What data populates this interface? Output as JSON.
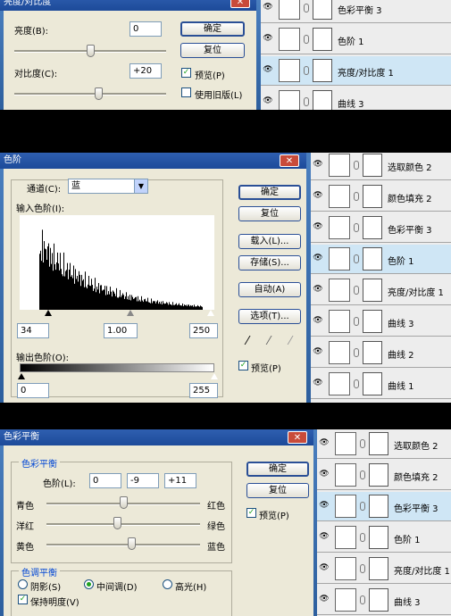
{
  "bc": {
    "title": "亮度/对比度",
    "close": "✕",
    "brightness_label": "亮度(B):",
    "brightness_value": "0",
    "contrast_label": "对比度(C):",
    "contrast_value": "+20",
    "ok": "确定",
    "reset": "复位",
    "preview": "预览(P)",
    "legacy": "使用旧版(L)",
    "brightness_level": 0.5,
    "contrast_level": 0.55
  },
  "panel1": [
    {
      "name": "色彩平衡 3",
      "icon": "color-balance-icon",
      "selected": false
    },
    {
      "name": "色阶 1",
      "icon": "levels-icon",
      "selected": false
    },
    {
      "name": "亮度/对比度 1",
      "icon": "brightness-contrast-icon",
      "selected": true
    },
    {
      "name": "曲线 3",
      "icon": "curves-icon",
      "selected": false
    }
  ],
  "lv": {
    "title": "色阶",
    "close": "✕",
    "channel_label": "通道(C):",
    "channel_value": "蓝",
    "input_label": "输入色阶(I):",
    "input_black": "34",
    "input_gamma": "1.00",
    "input_white": "250",
    "output_label": "输出色阶(O):",
    "output_black": "0",
    "output_white": "255",
    "ok": "确定",
    "reset": "复位",
    "load": "载入(L)...",
    "save": "存储(S)...",
    "auto": "自动(A)",
    "options": "选项(T)...",
    "preview": "预览(P)"
  },
  "panel2": [
    {
      "name": "选取颜色 2",
      "icon": "selective-color-icon",
      "selected": false
    },
    {
      "name": "颜色填充 2",
      "icon": "color-fill-icon",
      "selected": false
    },
    {
      "name": "色彩平衡 3",
      "icon": "color-balance-icon",
      "selected": false
    },
    {
      "name": "色阶 1",
      "icon": "levels-icon",
      "selected": true
    },
    {
      "name": "亮度/对比度 1",
      "icon": "brightness-contrast-icon",
      "selected": false
    },
    {
      "name": "曲线 3",
      "icon": "curves-icon",
      "selected": false
    },
    {
      "name": "曲线 2",
      "icon": "curves-icon",
      "selected": false
    },
    {
      "name": "曲线 1",
      "icon": "curves-icon",
      "selected": false
    }
  ],
  "cb": {
    "title": "色彩平衡",
    "close": "✕",
    "group_title": "色彩平衡",
    "levels_label": "色阶(L):",
    "v1": "0",
    "v2": "-9",
    "v3": "+11",
    "cyan": "青色",
    "red": "红色",
    "magenta": "洋红",
    "green": "绿色",
    "yellow": "黄色",
    "blue": "蓝色",
    "tone_title": "色调平衡",
    "shadows": "阴影(S)",
    "midtones": "中间调(D)",
    "highlights": "高光(H)",
    "preserve": "保持明度(V)",
    "ok": "确定",
    "reset": "复位",
    "preview": "预览(P)",
    "slider_levels": [
      0.5,
      0.46,
      0.55
    ]
  },
  "panel3": [
    {
      "name": "选取颜色 2",
      "icon": "selective-color-icon",
      "selected": false
    },
    {
      "name": "颜色填充 2",
      "icon": "color-fill-icon",
      "selected": false
    },
    {
      "name": "色彩平衡 3",
      "icon": "color-balance-icon",
      "selected": true
    },
    {
      "name": "色阶 1",
      "icon": "levels-icon",
      "selected": false
    },
    {
      "name": "亮度/对比度 1",
      "icon": "brightness-contrast-icon",
      "selected": false
    },
    {
      "name": "曲线 3",
      "icon": "curves-icon",
      "selected": false
    }
  ]
}
